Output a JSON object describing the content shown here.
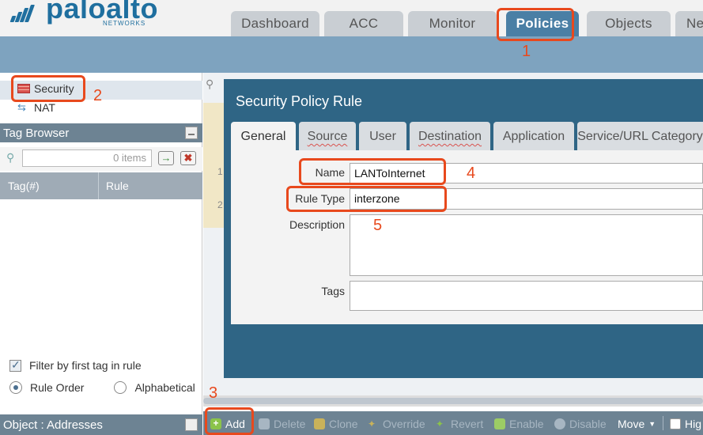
{
  "brand": {
    "name": "paloalto",
    "sub": "NETWORKS"
  },
  "tabs": [
    "Dashboard",
    "ACC",
    "Monitor",
    "Policies",
    "Objects",
    "Ne"
  ],
  "active_tab": "Policies",
  "sidebar": {
    "security": "Security",
    "nat": "NAT"
  },
  "tag_browser": {
    "title": "Tag Browser",
    "items_count": "0 items",
    "col_tag": "Tag(#)",
    "col_rule": "Rule",
    "filter_label": "Filter by first tag in rule",
    "radio_rule_order": "Rule Order",
    "radio_alphabetical": "Alphabetical"
  },
  "object_panel": {
    "title": "Object : Addresses"
  },
  "rows": [
    "1",
    "2"
  ],
  "dialog": {
    "title": "Security Policy Rule",
    "tabs": [
      "General",
      "Source",
      "User",
      "Destination",
      "Application",
      "Service/URL Category"
    ],
    "fields": {
      "name_label": "Name",
      "name_value": "LANToInternet",
      "rule_type_label": "Rule Type",
      "rule_type_value": "interzone",
      "description_label": "Description",
      "tags_label": "Tags"
    }
  },
  "toolbar": {
    "add": "Add",
    "delete": "Delete",
    "clone": "Clone",
    "override": "Override",
    "revert": "Revert",
    "enable": "Enable",
    "disable": "Disable",
    "move": "Move",
    "highlight": "Hig"
  },
  "annotations": [
    "1",
    "2",
    "3",
    "4",
    "5"
  ],
  "colors": {
    "accent": "#e8491d",
    "active_tab": "#4a7fa5",
    "dialog": "#2f6585",
    "brand": "#1f6f9f"
  }
}
